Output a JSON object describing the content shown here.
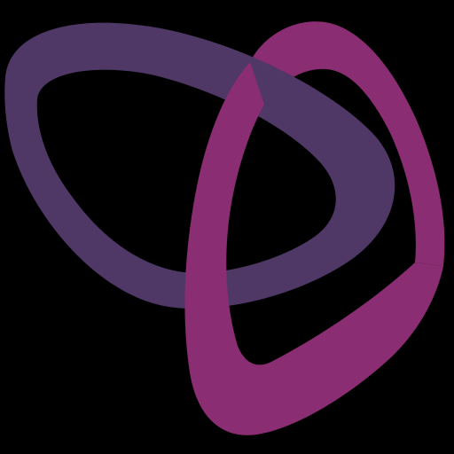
{
  "logo": {
    "name": "interlocking-loops-logo",
    "background_color": "#000000",
    "loops": [
      {
        "name": "purple-loop",
        "color": "#4f3766"
      },
      {
        "name": "magenta-loop",
        "color": "#8a2d72"
      }
    ]
  }
}
